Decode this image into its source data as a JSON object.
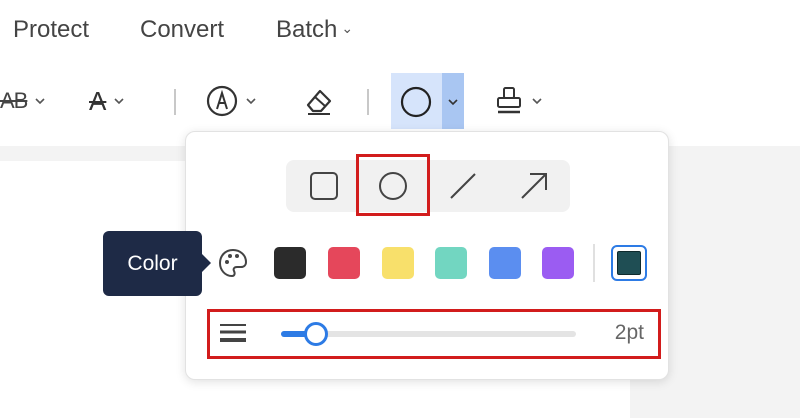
{
  "menu": {
    "items": [
      {
        "label": "Protect"
      },
      {
        "label": "Convert"
      },
      {
        "label": "Batch"
      }
    ]
  },
  "toolbar": {
    "tools": [
      {
        "name": "text-strikeout-icon",
        "text": "AB"
      },
      {
        "name": "text-format-icon",
        "text": "A"
      },
      {
        "name": "pen-circle-icon"
      },
      {
        "name": "eraser-icon"
      },
      {
        "name": "shape-circle-icon",
        "active": true
      },
      {
        "name": "stamp-icon"
      }
    ]
  },
  "shape_popover": {
    "shapes": [
      "rectangle-icon",
      "circle-icon",
      "line-icon",
      "arrow-icon"
    ],
    "selected_shape": "circle",
    "colors": [
      "#2b2b2b",
      "#e5475b",
      "#f8e06b",
      "#72d6c1",
      "#5b8ef0",
      "#9b5cf2"
    ],
    "selected_color": "#1f4e54",
    "stroke_width": {
      "value": 2,
      "label": "2pt",
      "fraction": 0.12
    },
    "tooltip": "Color"
  }
}
